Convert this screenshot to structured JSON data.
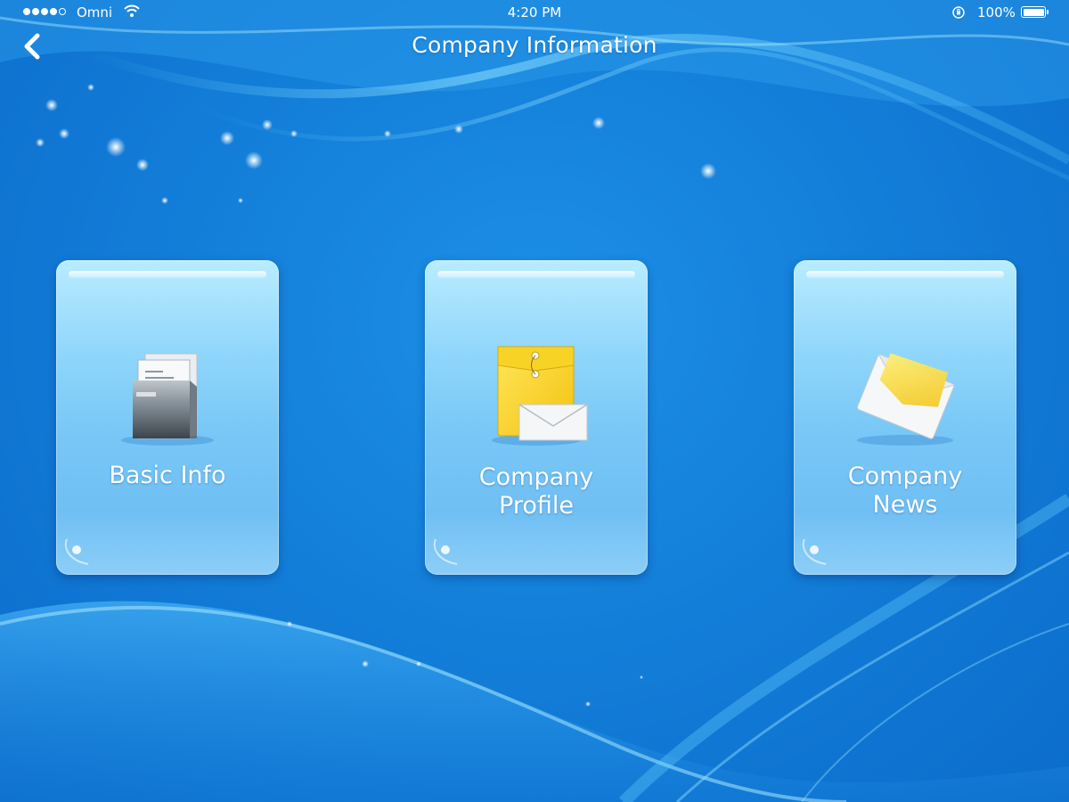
{
  "status_bar": {
    "carrier": "Omni",
    "time": "4:20 PM",
    "battery": "100%"
  },
  "nav": {
    "title": "Company Information",
    "back_icon": "chevron-left-icon"
  },
  "cards": [
    {
      "id": "basic",
      "label_line1": "Basic Info",
      "label_line2": "",
      "icon": "document-stack-icon"
    },
    {
      "id": "profile",
      "label_line1": "Company",
      "label_line2": "Profile",
      "icon": "envelope-folder-icon"
    },
    {
      "id": "news",
      "label_line1": "Company",
      "label_line2": "News",
      "icon": "open-envelope-icon"
    }
  ],
  "colors": {
    "background": "#137fd9",
    "card_top": "#b9ecff",
    "card_bottom": "#70bff4",
    "text": "#ffffff"
  }
}
